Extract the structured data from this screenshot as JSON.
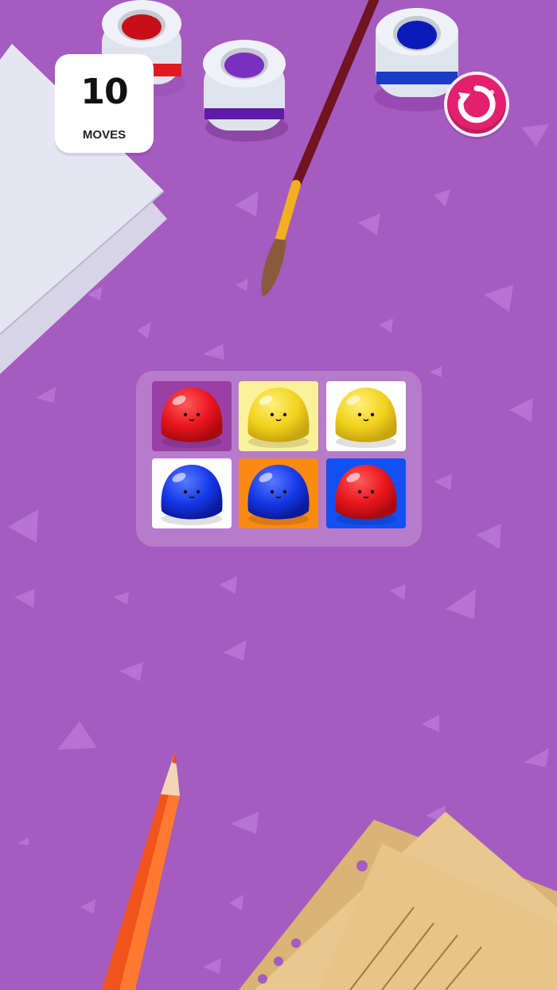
{
  "hud": {
    "moves_count": "10",
    "moves_label": "MOVES"
  },
  "restart_icon": "restart-icon",
  "colors": {
    "background": "#a55bc0",
    "red": "#e8141c",
    "yellow": "#f2d21c",
    "blue": "#1437e8",
    "restart": "#e2206e"
  },
  "board": {
    "rows": [
      [
        {
          "tile": "#9a3fa6",
          "blob": "red"
        },
        {
          "tile": "#fbf19a",
          "blob": "yellow"
        },
        {
          "tile": "#ffffff",
          "blob": "yellow"
        }
      ],
      [
        {
          "tile": "#ffffff",
          "blob": "blue"
        },
        {
          "tile": "#fb8a14",
          "blob": "blue"
        },
        {
          "tile": "#1250f2",
          "blob": "red"
        }
      ]
    ]
  },
  "paint_pots": [
    "red",
    "purple",
    "blue"
  ]
}
